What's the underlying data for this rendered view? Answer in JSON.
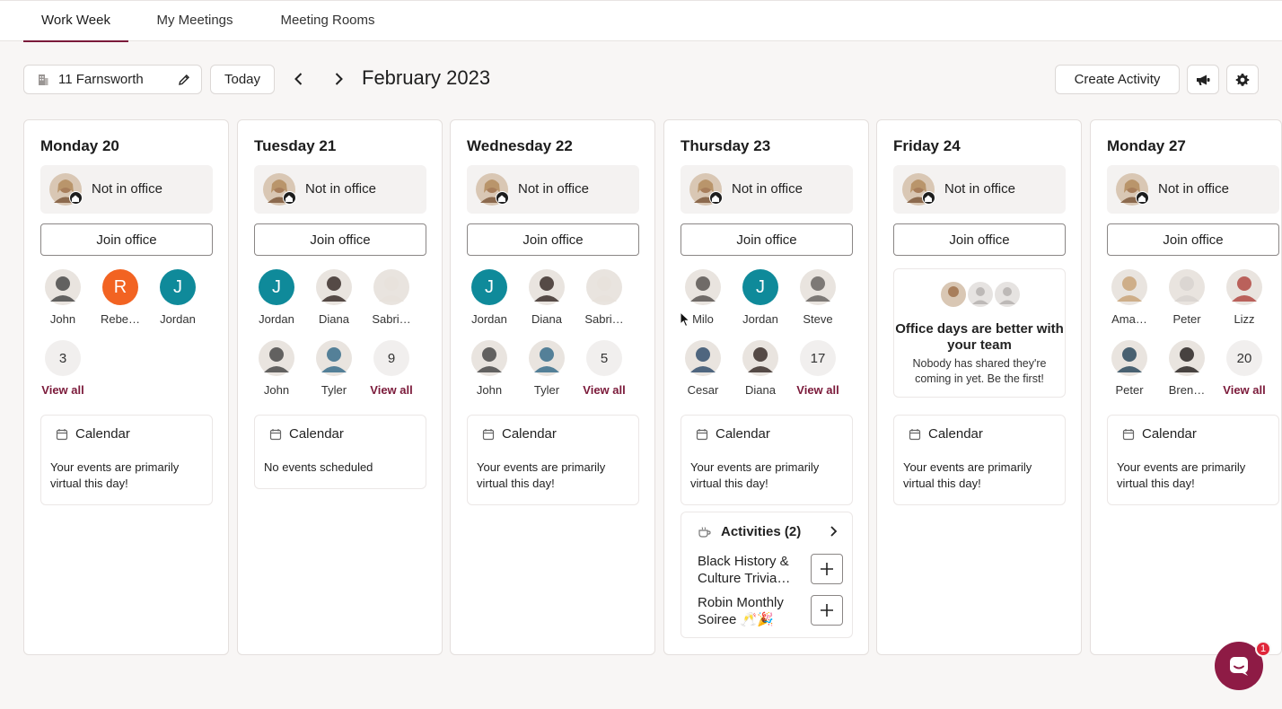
{
  "tabs": [
    {
      "label": "Work Week",
      "active": true
    },
    {
      "label": "My Meetings",
      "active": false
    },
    {
      "label": "Meeting Rooms",
      "active": false
    }
  ],
  "toolbar": {
    "office": "11 Farnsworth",
    "today": "Today",
    "month": "February 2023",
    "create_activity": "Create Activity"
  },
  "colors": {
    "accent": "#7b1a3a",
    "teal": "#0f8a9a",
    "orange": "#f26322"
  },
  "days": [
    {
      "title": "Monday 20",
      "status": "Not in office",
      "join": "Join office",
      "people": [
        {
          "name": "John",
          "type": "photo",
          "tone": "#4a4a4a"
        },
        {
          "name": "Rebe…",
          "type": "initial",
          "initial": "R",
          "color": "#f26322"
        },
        {
          "name": "Jordan",
          "type": "initial",
          "initial": "J",
          "color": "#0f8a9a"
        },
        {
          "name": "View all",
          "type": "count",
          "count": "3"
        }
      ],
      "calendar": {
        "title": "Calendar",
        "body": "Your events are primarily virtual this day!"
      }
    },
    {
      "title": "Tuesday 21",
      "status": "Not in office",
      "join": "Join office",
      "people": [
        {
          "name": "Jordan",
          "type": "initial",
          "initial": "J",
          "color": "#0f8a9a"
        },
        {
          "name": "Diana",
          "type": "photo",
          "tone": "#3b2f2c"
        },
        {
          "name": "Sabri…",
          "type": "photo",
          "tone": "#e8e2dc"
        },
        {
          "name": "John",
          "type": "photo",
          "tone": "#4a4a4a"
        },
        {
          "name": "Tyler",
          "type": "photo",
          "tone": "#3a6f8c"
        },
        {
          "name": "View all",
          "type": "count",
          "count": "9"
        }
      ],
      "calendar": {
        "title": "Calendar",
        "body": "No events scheduled"
      }
    },
    {
      "title": "Wednesday 22",
      "status": "Not in office",
      "join": "Join office",
      "people": [
        {
          "name": "Jordan",
          "type": "initial",
          "initial": "J",
          "color": "#0f8a9a"
        },
        {
          "name": "Diana",
          "type": "photo",
          "tone": "#3b2f2c"
        },
        {
          "name": "Sabri…",
          "type": "photo",
          "tone": "#e8e2dc"
        },
        {
          "name": "John",
          "type": "photo",
          "tone": "#4a4a4a"
        },
        {
          "name": "Tyler",
          "type": "photo",
          "tone": "#3a6f8c"
        },
        {
          "name": "View all",
          "type": "count",
          "count": "5"
        }
      ],
      "calendar": {
        "title": "Calendar",
        "body": "Your events are primarily virtual this day!"
      }
    },
    {
      "title": "Thursday 23",
      "status": "Not in office",
      "join": "Join office",
      "people": [
        {
          "name": "Milo",
          "type": "photo",
          "tone": "#5a5654"
        },
        {
          "name": "Jordan",
          "type": "initial",
          "initial": "J",
          "color": "#0f8a9a"
        },
        {
          "name": "Steve",
          "type": "photo",
          "tone": "#6a6664"
        },
        {
          "name": "Cesar",
          "type": "photo",
          "tone": "#34506e"
        },
        {
          "name": "Diana",
          "type": "photo",
          "tone": "#3b2f2c"
        },
        {
          "name": "View all",
          "type": "count",
          "count": "17"
        }
      ],
      "calendar": {
        "title": "Calendar",
        "body": "Your events are primarily virtual this day!"
      },
      "activities": {
        "title": "Activities (2)",
        "items": [
          "Black History & Culture Trivia…",
          "Robin Monthly Soiree 🥂🎉"
        ]
      }
    },
    {
      "title": "Friday 24",
      "status": "Not in office",
      "join": "Join office",
      "team": {
        "title": "Office days are better with your team",
        "body": "Nobody has shared they're coming in yet. Be the first!"
      },
      "calendar": {
        "title": "Calendar",
        "body": "Your events are primarily virtual this day!"
      }
    },
    {
      "title": "Monday 27",
      "status": "Not in office",
      "join": "Join office",
      "people": [
        {
          "name": "Ama…",
          "type": "photo",
          "tone": "#c9a47a"
        },
        {
          "name": "Peter",
          "type": "photo",
          "tone": "#d8d4d0"
        },
        {
          "name": "Lizz",
          "type": "photo",
          "tone": "#b14a44"
        },
        {
          "name": "Peter",
          "type": "photo",
          "tone": "#2d4a5e"
        },
        {
          "name": "Bren…",
          "type": "photo",
          "tone": "#2a2624"
        },
        {
          "name": "View all",
          "type": "count",
          "count": "20"
        }
      ],
      "calendar": {
        "title": "Calendar",
        "body": "Your events are primarily virtual this day!"
      }
    }
  ],
  "chat": {
    "badge": "1"
  }
}
